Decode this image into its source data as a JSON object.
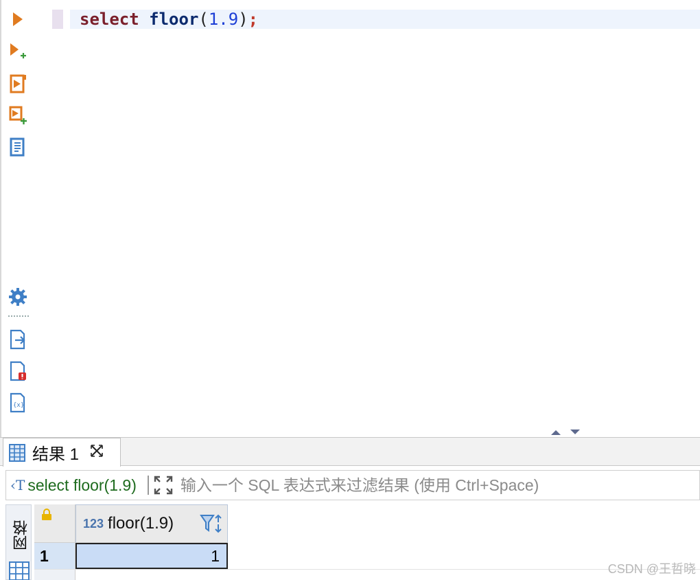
{
  "editor": {
    "code_tokens": [
      {
        "text": "select ",
        "cls": "kw"
      },
      {
        "text": "floor",
        "cls": "fn"
      },
      {
        "text": "(",
        "cls": "paren"
      },
      {
        "text": "1.9",
        "cls": "num"
      },
      {
        "text": ")",
        "cls": "paren"
      },
      {
        "text": ";",
        "cls": "semi"
      }
    ]
  },
  "toolbar": {
    "icons": [
      "execute-statement-icon",
      "execute-in-new-tab-icon",
      "execute-script-icon",
      "execute-script-new-tab-icon",
      "explain-plan-icon",
      "settings-icon",
      "export-icon",
      "error-log-icon",
      "variables-icon"
    ]
  },
  "results": {
    "tab_label": "结果 1",
    "tab_close": "⊠",
    "query_label": "select floor(1.9)",
    "query_icon": "‹T",
    "filter_placeholder": "输入一个 SQL 表达式来过滤结果 (使用 Ctrl+Space)",
    "side_label": "网格",
    "column": {
      "type": "123",
      "name": "floor(1.9)"
    },
    "rows": [
      {
        "num": "1",
        "value": "1"
      }
    ]
  },
  "watermark": "CSDN @王哲晓",
  "colors": {
    "accent": "#e07b20",
    "blue": "#3f7fc6",
    "selection": "#c9dcf6"
  }
}
